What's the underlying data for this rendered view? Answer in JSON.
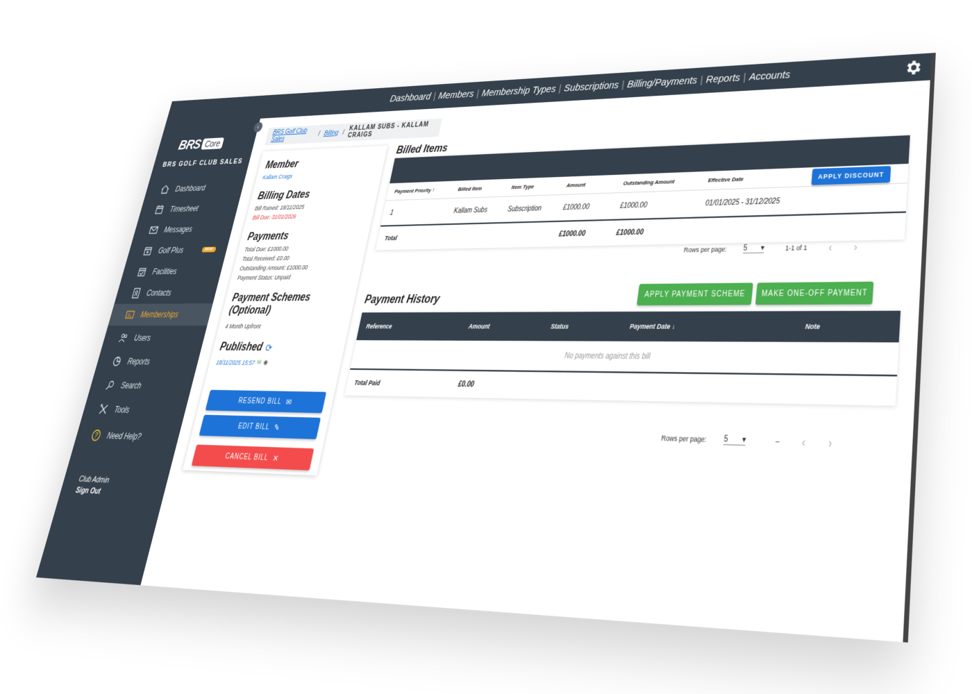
{
  "topnav": {
    "items": [
      "Dashboard",
      "Members",
      "Membership Types",
      "Subscriptions",
      "Billing/Payments",
      "Reports",
      "Accounts"
    ]
  },
  "sidebar": {
    "logo_brs": "BRS",
    "logo_core": "Core",
    "club_name": "BRS GOLF CLUB SALES",
    "items": [
      {
        "label": "Dashboard",
        "icon": "home-icon"
      },
      {
        "label": "Timesheet",
        "icon": "calendar-icon"
      },
      {
        "label": "Messages",
        "icon": "envelope-icon"
      },
      {
        "label": "Golf Plus",
        "icon": "calendar-plus-icon",
        "badge": "NEW!"
      },
      {
        "label": "Facilities",
        "icon": "calendar-check-icon"
      },
      {
        "label": "Contacts",
        "icon": "address-book-icon"
      },
      {
        "label": "Memberships",
        "icon": "id-card-icon",
        "active": true
      },
      {
        "label": "Users",
        "icon": "users-icon"
      },
      {
        "label": "Reports",
        "icon": "pie-chart-icon"
      },
      {
        "label": "Search",
        "icon": "search-icon"
      },
      {
        "label": "Tools",
        "icon": "tools-icon"
      },
      {
        "label": "Need Help?",
        "icon": "help-icon"
      }
    ],
    "footer_user": "Club Admin",
    "footer_signout": "Sign Out"
  },
  "breadcrumb": {
    "crumb1": "BRS Golf Club Sales",
    "crumb2": "Billing",
    "current": "KALLAM SUBS - KALLAM CRAIGS"
  },
  "bill": {
    "member_title": "Member",
    "member_name": "Kallam Craigs",
    "dates_title": "Billing Dates",
    "bill_raised": "Bill Raised: 18/11/2025",
    "bill_due": "Bill Due: 31/01/2026",
    "payments_title": "Payments",
    "total_due": "Total Due: £1000.00",
    "total_received": "Total Received: £0.00",
    "outstanding": "Outstanding Amount: £1000.00",
    "status": "Payment Status: Unpaid",
    "schemes_title": "Payment Schemes (Optional)",
    "scheme": "4 Month Upfront",
    "published_title": "Published",
    "published_date": "18/11/2025 15:57",
    "resend_label": "RESEND BILL",
    "edit_label": "EDIT BILL",
    "cancel_label": "CANCEL BILL"
  },
  "billed_items": {
    "title": "Billed Items",
    "headers": [
      "Payment Priority",
      "Billed Item",
      "Item Type",
      "Amount",
      "Outstanding Amount",
      "Effective Date"
    ],
    "rows": [
      {
        "priority": "1",
        "item": "Kallam Subs",
        "type": "Subscription",
        "amount": "£1000.00",
        "outstanding": "£1000.00",
        "effective": "01/01/2025 - 31/12/2025"
      }
    ],
    "total_label": "Total",
    "total_amount": "£1000.00",
    "total_outstanding": "£1000.00",
    "apply_discount": "APPLY DISCOUNT",
    "rows_per_page_label": "Rows per page:",
    "rows_per_page": "5",
    "range": "1-1 of 1"
  },
  "payment_history": {
    "title": "Payment History",
    "apply_scheme": "APPLY PAYMENT SCHEME",
    "one_off": "MAKE ONE-OFF PAYMENT",
    "headers": [
      "Reference",
      "Amount",
      "Status",
      "Payment Date",
      "Note"
    ],
    "empty": "No payments against this bill",
    "total_label": "Total Paid",
    "total_value": "£0.00",
    "rows_per_page_label": "Rows per page:",
    "rows_per_page": "5",
    "range": "–"
  },
  "colors": {
    "sidebar": "#34404c",
    "accent_orange": "#f0a92b",
    "blue": "#1e73d8",
    "green": "#4caf50",
    "red": "#f44c4c"
  }
}
